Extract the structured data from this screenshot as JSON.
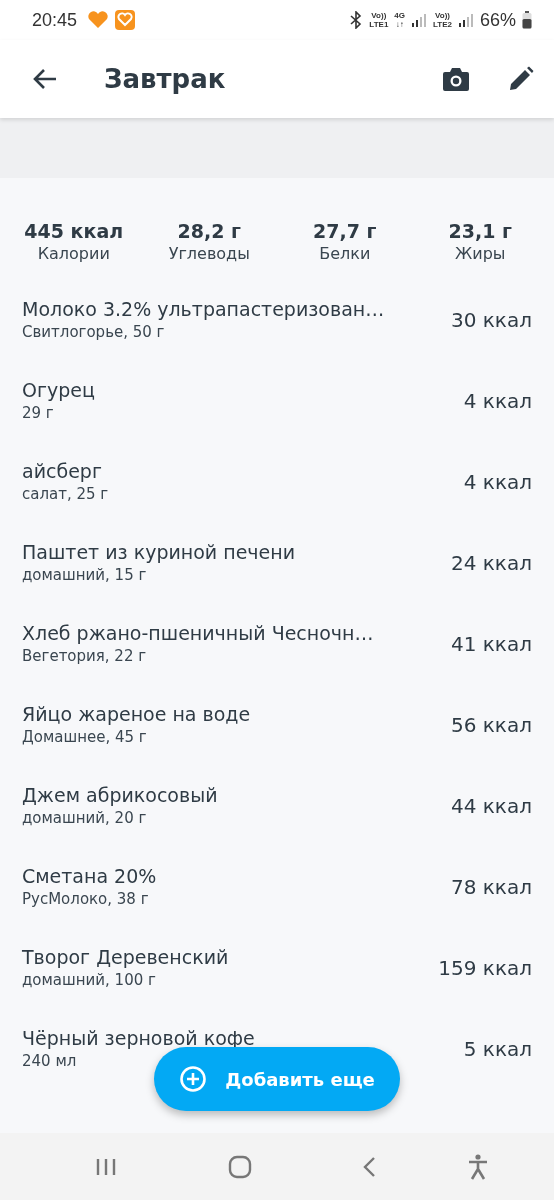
{
  "status_bar": {
    "time": "20:45",
    "volte1": "Vo))",
    "lte1": "LTE1",
    "net": "4G",
    "net_arrows": "↓↑",
    "volte2": "Vo))",
    "lte2": "LTE2",
    "battery": "66%"
  },
  "header": {
    "title": "Завтрак"
  },
  "summary": [
    {
      "value": "445 ккал",
      "label": "Калории"
    },
    {
      "value": "28,2 г",
      "label": "Углеводы"
    },
    {
      "value": "27,7 г",
      "label": "Белки"
    },
    {
      "value": "23,1 г",
      "label": "Жиры"
    }
  ],
  "items": [
    {
      "name": "Молоко 3.2% ультрапастеризован…",
      "detail": "Свитлогорье, 50 г",
      "calories": "30 ккал"
    },
    {
      "name": "Огурец",
      "detail": "29 г",
      "calories": "4 ккал"
    },
    {
      "name": "айсберг",
      "detail": "салат, 25 г",
      "calories": "4 ккал"
    },
    {
      "name": "Паштет из куриной печени",
      "detail": "домашний, 15 г",
      "calories": "24 ккал"
    },
    {
      "name": "Хлеб ржано-пшеничный Чесночн…",
      "detail": "Вегетория, 22 г",
      "calories": "41 ккал"
    },
    {
      "name": "Яйцо жареное на воде",
      "detail": "Домашнее, 45 г",
      "calories": "56 ккал"
    },
    {
      "name": "Джем абрикосовый",
      "detail": "домашний, 20 г",
      "calories": "44 ккал"
    },
    {
      "name": "Сметана 20%",
      "detail": "РусМолоко, 38 г",
      "calories": "78 ккал"
    },
    {
      "name": "Творог Деревенский",
      "detail": "домашний, 100 г",
      "calories": "159 ккал"
    },
    {
      "name": "Чёрный зерновой кофе",
      "detail": "240 мл",
      "calories": "5 ккал"
    }
  ],
  "add_button": {
    "label": "Добавить еще"
  }
}
